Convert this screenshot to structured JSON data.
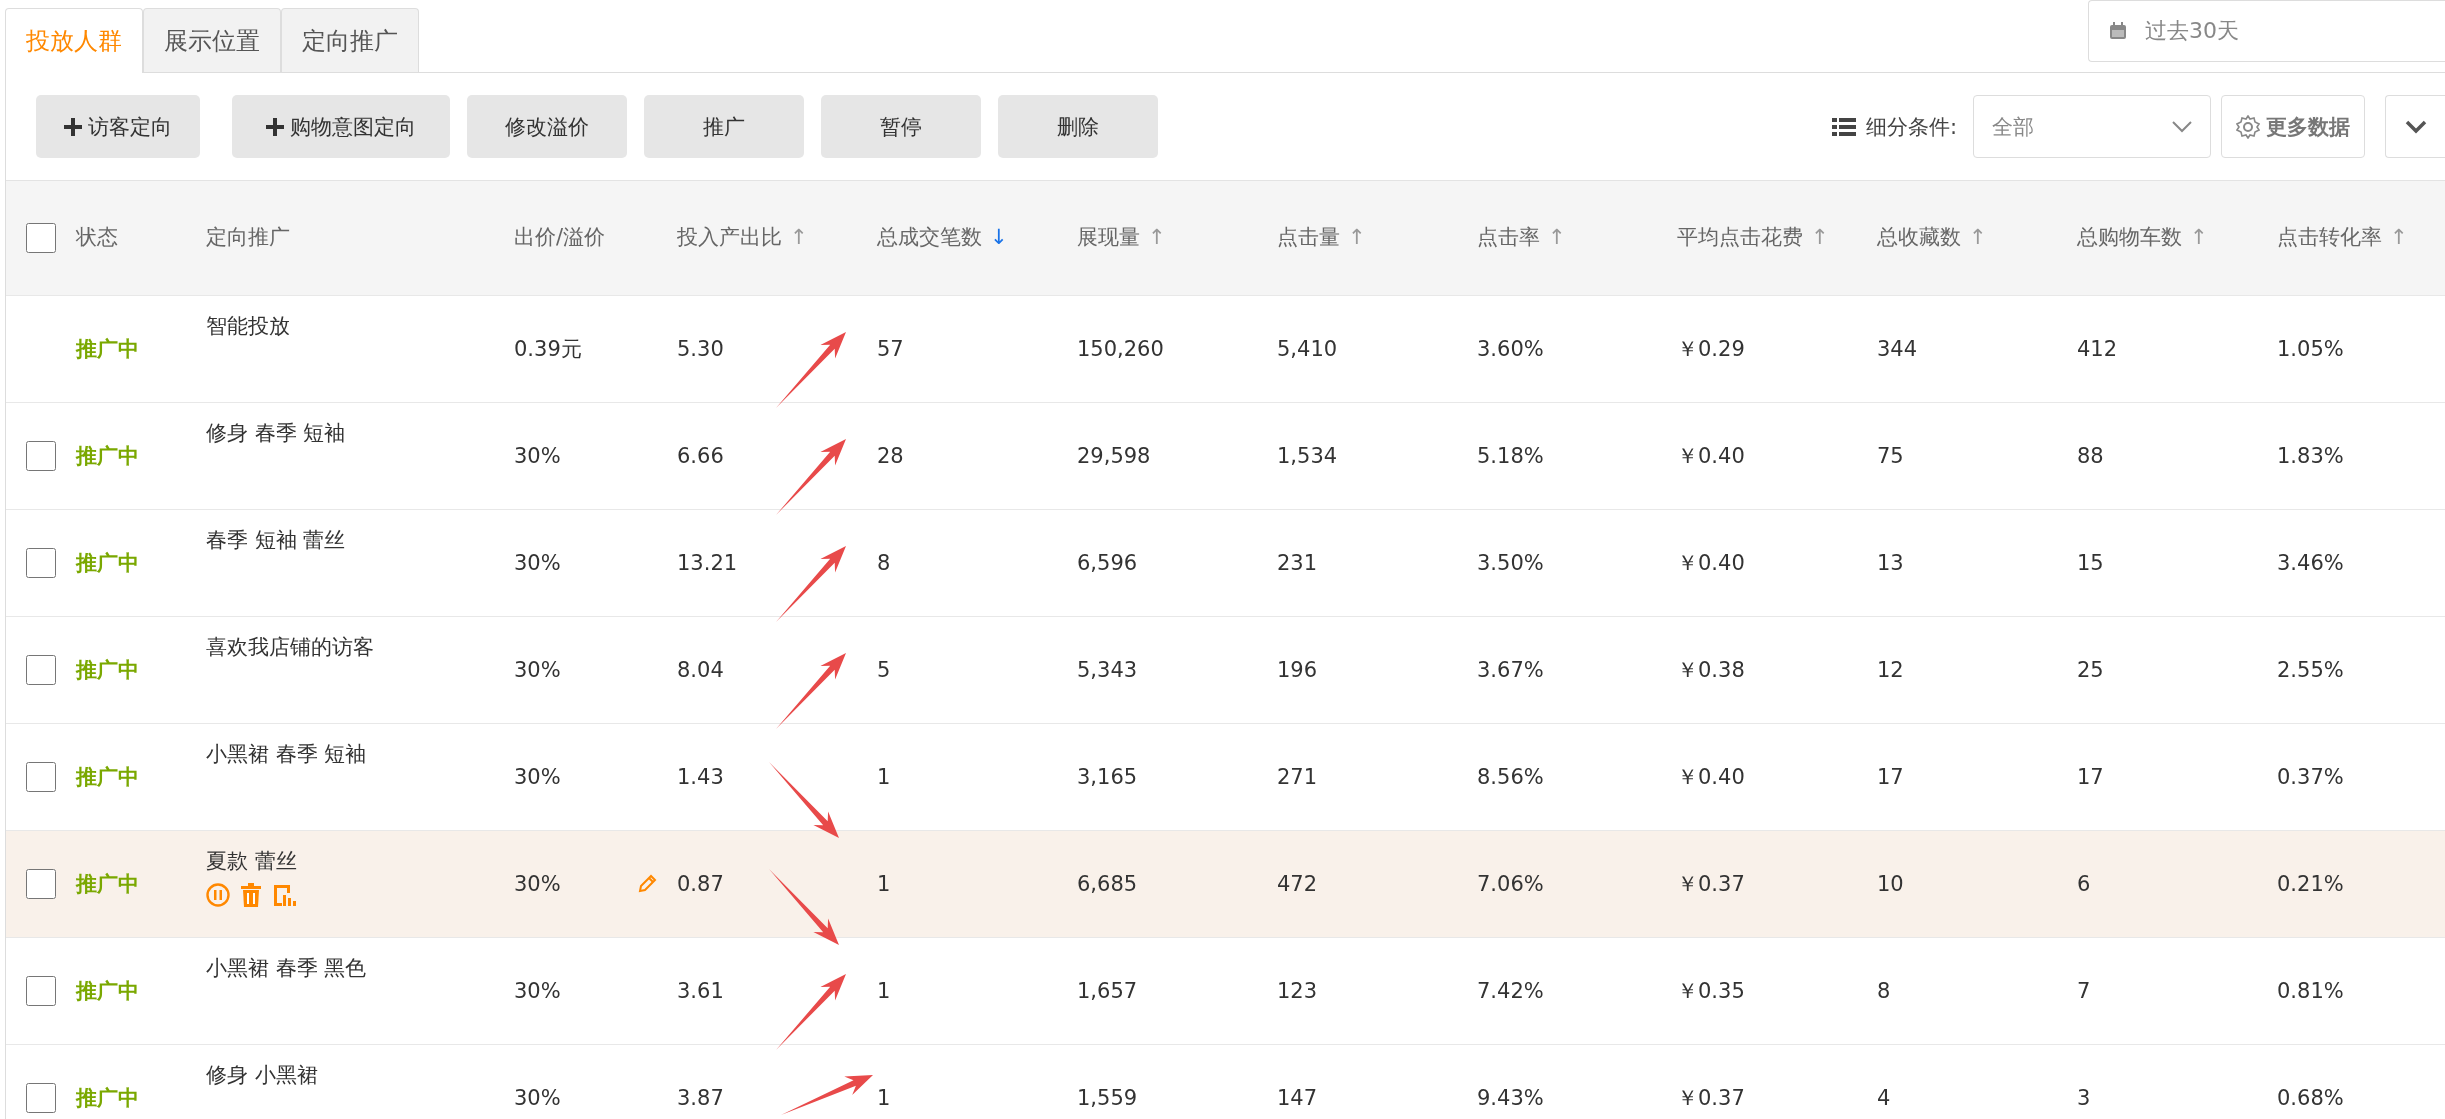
{
  "tabs": [
    {
      "label": "投放人群",
      "selected": true
    },
    {
      "label": "展示位置",
      "selected": false
    },
    {
      "label": "定向推广",
      "selected": false
    }
  ],
  "date_range": {
    "value": "过去30天"
  },
  "toolbar": {
    "buttons": [
      {
        "label": "访客定向",
        "kind": "add"
      },
      {
        "label": "购物意图定向",
        "kind": "add"
      },
      {
        "label": "修改溢价",
        "kind": "plain"
      },
      {
        "label": "推广",
        "kind": "plain"
      },
      {
        "label": "暂停",
        "kind": "plain"
      },
      {
        "label": "删除",
        "kind": "plain"
      }
    ],
    "filter_label": "细分条件:",
    "filter_value": "全部",
    "more_button": "更多数据"
  },
  "table": {
    "select_all_checked": false,
    "columns": [
      {
        "label": "状态"
      },
      {
        "label": "定向推广"
      },
      {
        "label": "出价/溢价"
      },
      {
        "label": "投入产出比",
        "sort": "↑",
        "active": false
      },
      {
        "label": "总成交笔数",
        "sort": "↓",
        "active": true
      },
      {
        "label": "展现量",
        "sort": "↑",
        "active": false
      },
      {
        "label": "点击量",
        "sort": "↑",
        "active": false
      },
      {
        "label": "点击率",
        "sort": "↑",
        "active": false
      },
      {
        "label": "平均点击花费",
        "sort": "↑",
        "active": false
      },
      {
        "label": "总收藏数",
        "sort": "↑",
        "active": false
      },
      {
        "label": "总购物车数",
        "sort": "↑",
        "active": false
      },
      {
        "label": "点击转化率",
        "sort": "↑",
        "active": false
      }
    ],
    "rows": [
      {
        "cells": [
          "推广中",
          "智能投放",
          "0.39元",
          "5.30",
          "57",
          "150,260",
          "5,410",
          "3.60%",
          "￥0.29",
          "344",
          "412",
          "1.05%"
        ],
        "hovered": false,
        "kind": "up"
      },
      {
        "checked": false,
        "cells": [
          "推广中",
          "修身 春季 短袖",
          "30%",
          "6.66",
          "28",
          "29,598",
          "1,534",
          "5.18%",
          "￥0.40",
          "75",
          "88",
          "1.83%"
        ],
        "hovered": false,
        "kind": "up"
      },
      {
        "checked": false,
        "cells": [
          "推广中",
          "春季 短袖 蕾丝",
          "30%",
          "13.21",
          "8",
          "6,596",
          "231",
          "3.50%",
          "￥0.40",
          "13",
          "15",
          "3.46%"
        ],
        "hovered": false,
        "kind": "up"
      },
      {
        "checked": false,
        "cells": [
          "推广中",
          "喜欢我店铺的访客",
          "30%",
          "8.04",
          "5",
          "5,343",
          "196",
          "3.67%",
          "￥0.38",
          "12",
          "25",
          "2.55%"
        ],
        "hovered": false,
        "kind": "up"
      },
      {
        "checked": false,
        "cells": [
          "推广中",
          "小黑裙 春季 短袖",
          "30%",
          "1.43",
          "1",
          "3,165",
          "271",
          "8.56%",
          "￥0.40",
          "17",
          "17",
          "0.37%"
        ],
        "hovered": false,
        "kind": "down"
      },
      {
        "checked": false,
        "cells": [
          "推广中",
          "夏款 蕾丝",
          "30%",
          "0.87",
          "1",
          "6,685",
          "472",
          "7.06%",
          "￥0.37",
          "10",
          "6",
          "0.21%"
        ],
        "hovered": true,
        "kind": "down"
      },
      {
        "checked": false,
        "cells": [
          "推广中",
          "小黑裙 春季 黑色",
          "30%",
          "3.61",
          "1",
          "1,657",
          "123",
          "7.42%",
          "￥0.35",
          "8",
          "7",
          "0.81%"
        ],
        "hovered": false,
        "kind": "up"
      },
      {
        "checked": false,
        "cells": [
          "推广中",
          "修身 小黑裙",
          "30%",
          "3.87",
          "1",
          "1,559",
          "147",
          "9.43%",
          "￥0.37",
          "4",
          "3",
          "0.68%"
        ],
        "hovered": false,
        "kind": "up_flat"
      }
    ]
  }
}
